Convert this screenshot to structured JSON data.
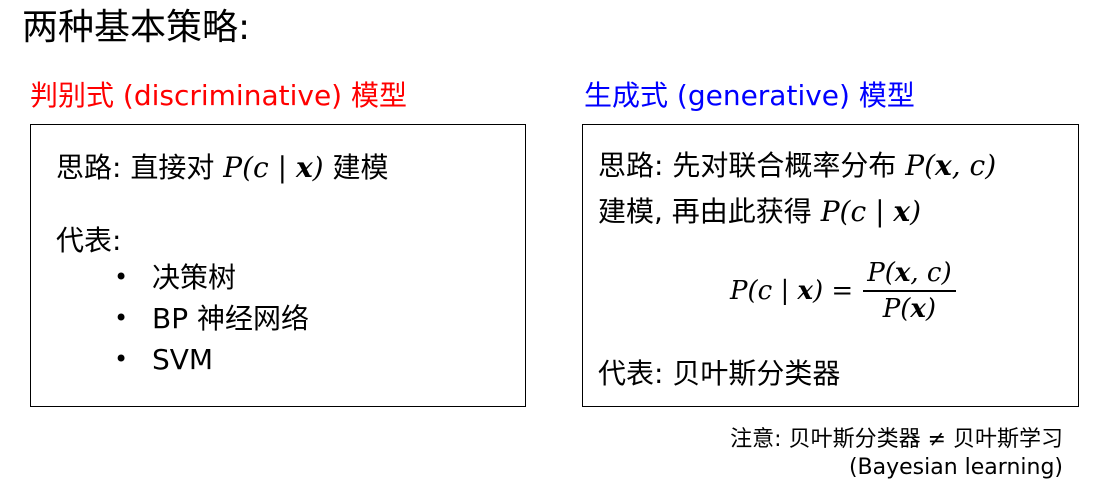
{
  "title": "两种基本策略:",
  "discriminative": {
    "heading": "判别式 (discriminative) 模型",
    "idea_label": "思路: 直接对",
    "idea_suffix": "建模",
    "rep_label": "代表:",
    "items": [
      "决策树",
      "BP 神经网络",
      "SVM"
    ]
  },
  "generative": {
    "heading": "生成式 (generative) 模型",
    "idea_line1": "思路: 先对联合概率分布",
    "idea_line2": "建模, 再由此获得",
    "rep": "代表: 贝叶斯分类器"
  },
  "note": {
    "line1": "注意: 贝叶斯分类器  ≠  贝叶斯学习",
    "line2": "(Bayesian learning)"
  },
  "colors": {
    "discriminative_heading": "#ff0000",
    "generative_heading": "#0000ff"
  }
}
